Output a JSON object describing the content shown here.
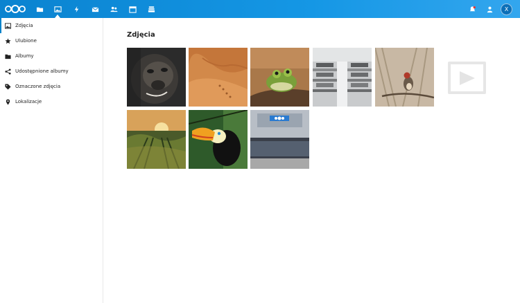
{
  "app": {
    "header_icons": [
      {
        "name": "files-icon",
        "active": false
      },
      {
        "name": "photos-icon",
        "active": true
      },
      {
        "name": "activity-icon",
        "active": false
      },
      {
        "name": "mail-icon",
        "active": false
      },
      {
        "name": "contacts-icon",
        "active": false
      },
      {
        "name": "calendar-icon",
        "active": false
      },
      {
        "name": "deck-icon",
        "active": false
      }
    ],
    "user_initial": "X",
    "accent": "#0082c9"
  },
  "sidebar": {
    "items": [
      {
        "label": "Zdjęcia",
        "icon": "image-icon",
        "active": true
      },
      {
        "label": "Ulubione",
        "icon": "star-icon",
        "active": false
      },
      {
        "label": "Albumy",
        "icon": "folder-icon",
        "active": false
      },
      {
        "label": "Udostępnione albumy",
        "icon": "share-icon",
        "active": false
      },
      {
        "label": "Oznaczone zdjęcia",
        "icon": "tag-icon",
        "active": false
      },
      {
        "label": "Lokalizacje",
        "icon": "location-icon",
        "active": false
      }
    ]
  },
  "main": {
    "title": "Zdjęcia"
  }
}
